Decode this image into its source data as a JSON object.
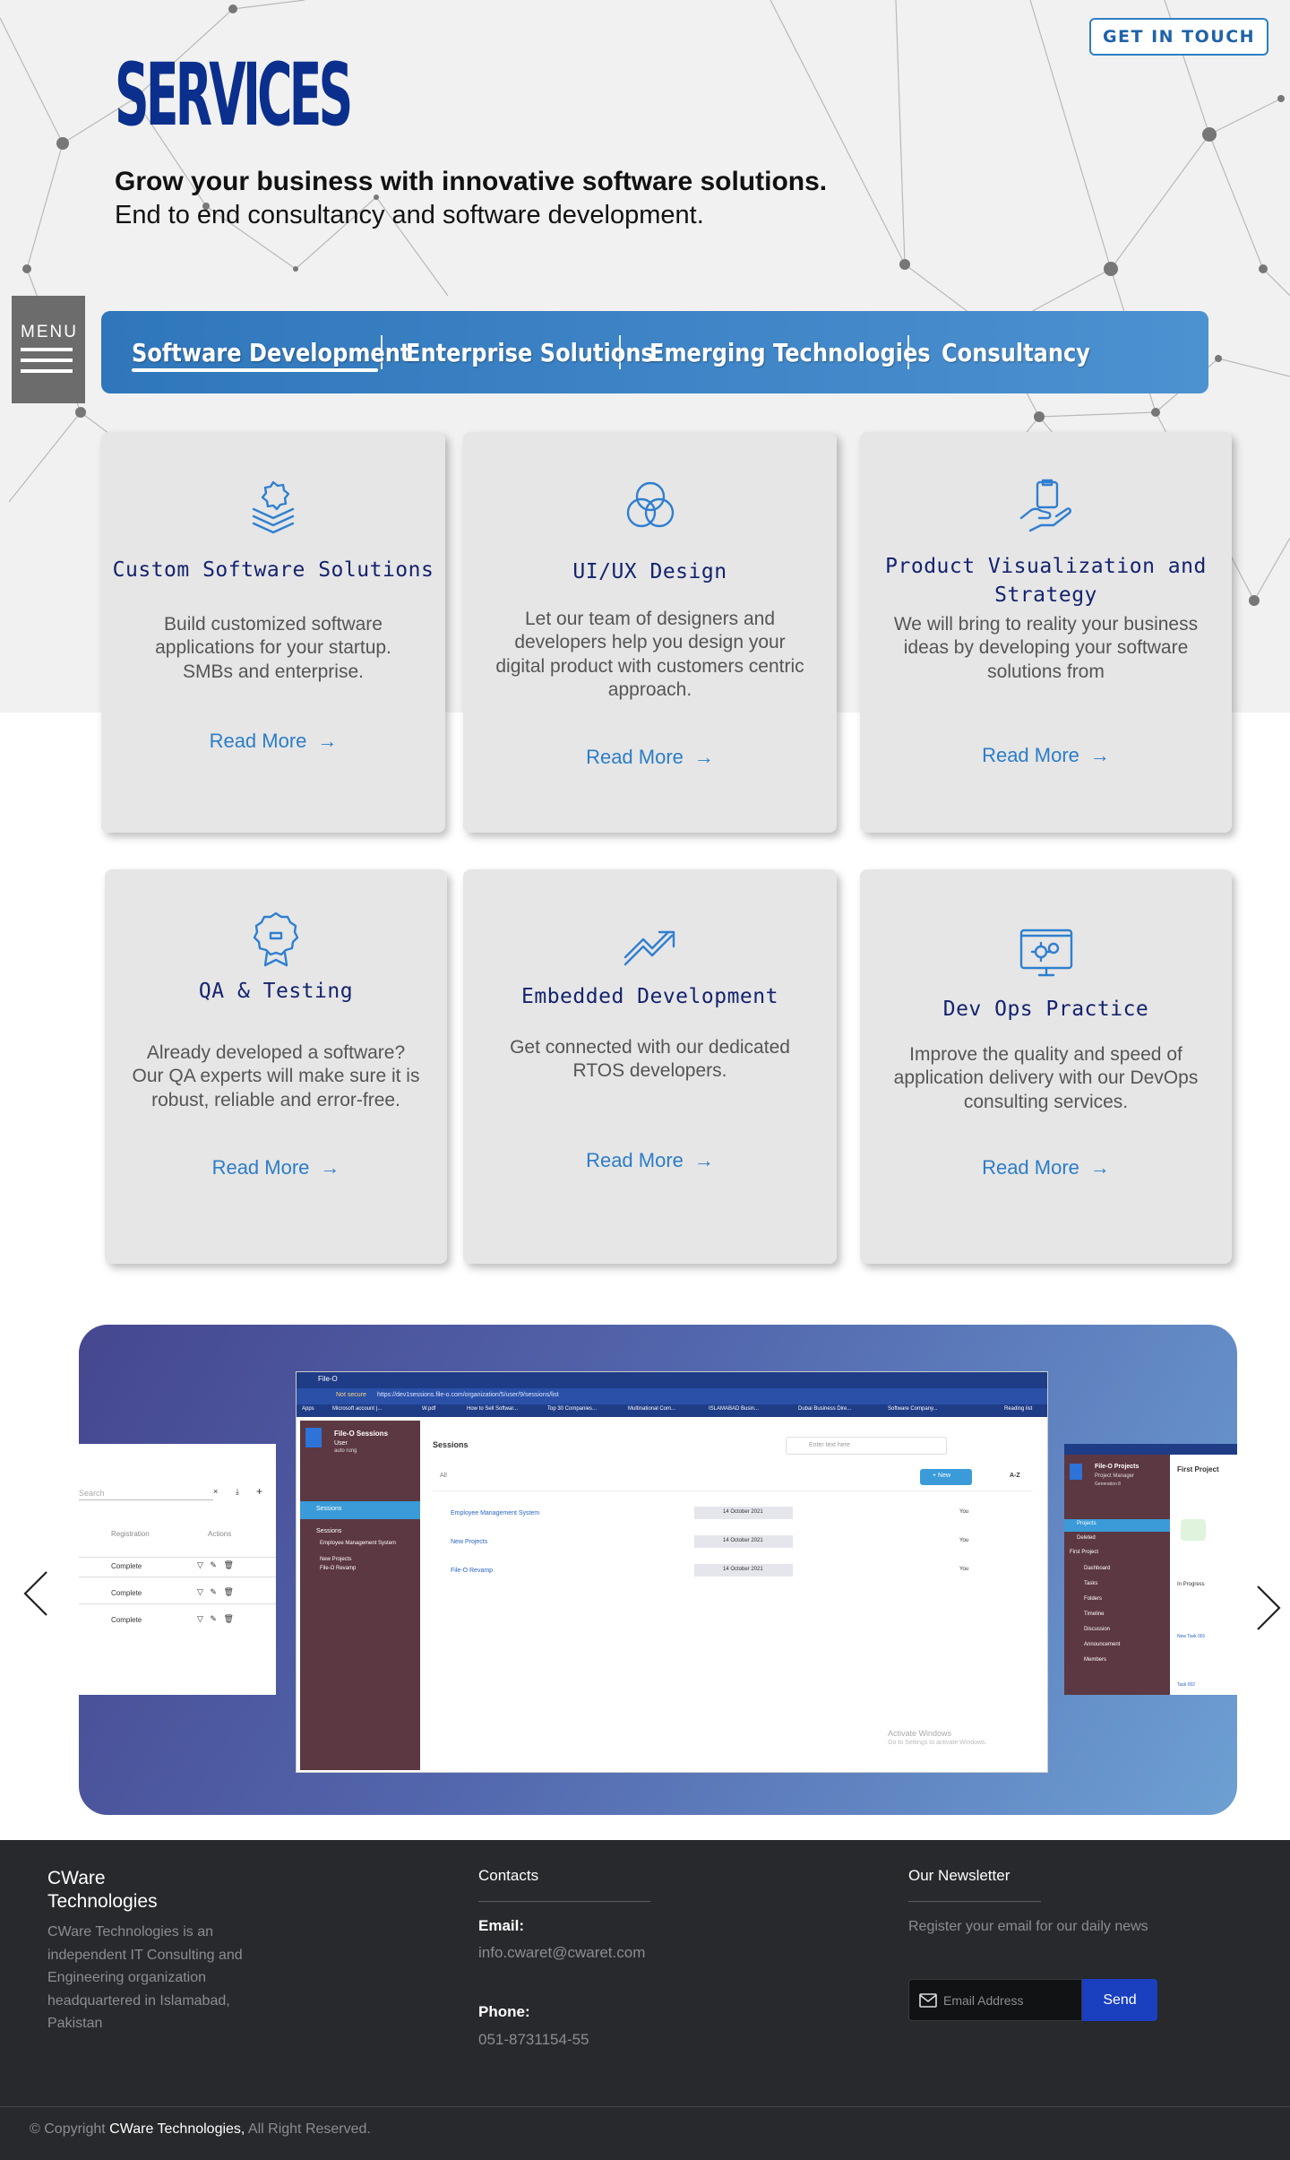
{
  "header": {
    "get_in_touch": "GET IN TOUCH",
    "title": "SERVICES",
    "tagline": "Grow your business with innovative software solutions.",
    "subline": "End to end consultancy and software development.",
    "menu_label": "MENU"
  },
  "tabs": [
    {
      "label": "Software Development",
      "active": true
    },
    {
      "label": "Enterprise Solutions",
      "active": false
    },
    {
      "label": "Emerging Technologies",
      "active": false
    },
    {
      "label": "Consultancy",
      "active": false
    }
  ],
  "cards": [
    {
      "icon": "layers-gear-icon",
      "title": "Custom Software Solutions",
      "desc": "Build customized software applications for your startup. SMBs and enterprise.",
      "link": "Read More"
    },
    {
      "icon": "venn-circles-icon",
      "title": "UI/UX Design",
      "desc": "Let our team of designers and developers help you design your digital product with customers centric approach.",
      "link": "Read More"
    },
    {
      "icon": "hand-clipboard-icon",
      "title": "Product Visualization and Strategy",
      "desc": "We will bring to reality your business ideas by developing your software solutions from",
      "link": "Read More"
    },
    {
      "icon": "badge-award-icon",
      "title": "QA & Testing",
      "desc": "Already developed a software? Our QA experts will make sure it is robust, reliable and error-free.",
      "link": "Read More"
    },
    {
      "icon": "trend-arrow-icon",
      "title": "Embedded Development",
      "desc": "Get connected with our dedicated RTOS developers.",
      "link": "Read More"
    },
    {
      "icon": "monitor-gears-icon",
      "title": "Dev Ops Practice",
      "desc": "Improve the quality and speed of application delivery with our DevOps consulting services.",
      "link": "Read More"
    }
  ],
  "slider": {
    "main": {
      "tab_title": "File-O",
      "url": "https://dev1sessions.file-o.com/organization/5/user/9/sessions/list",
      "not_secure": "Not secure",
      "bookmarks": [
        "Apps",
        "Microsoft account |...",
        "W.pdf",
        "How to Sell Softwar...",
        "Top 30 Companies...",
        "Multinational Com...",
        "ISLAMABAD Busin...",
        "Dubai Business Dire...",
        "Software Company...",
        "Reading list"
      ],
      "app_name": "File-O Sessions",
      "user": "User",
      "user_role": "auto rung",
      "nav_active": "Sessions",
      "nav_items": [
        "Sessions",
        "Employee Management System",
        "New Projects",
        "File-O Revamp"
      ],
      "page_title": "Sessions",
      "search_placeholder": "Enter text here",
      "filter": "All",
      "new_button": "+ New",
      "sort_button": "A-Z",
      "rows": [
        {
          "name": "Employee Management System",
          "date": "14 October 2021",
          "owner": "You"
        },
        {
          "name": "New Projects",
          "date": "14 October 2021",
          "owner": "You"
        },
        {
          "name": "File-O Revamp",
          "date": "14 October 2021",
          "owner": "You"
        }
      ],
      "watermark": "Activate Windows",
      "watermark_sub": "Go to Settings to activate Windows."
    },
    "left": {
      "search": "Search",
      "col_registration": "Registration",
      "col_actions": "Actions",
      "rows": [
        "Complete",
        "Complete",
        "Complete"
      ]
    },
    "right": {
      "app_name": "File-O Projects",
      "user_role": "Project Manager",
      "user_sub": "Generation 8",
      "nav_items": [
        "Projects",
        "Deleted",
        "First Project",
        "Dashboard",
        "Tasks",
        "Folders",
        "Timeline",
        "Discussion",
        "Announcement",
        "Members"
      ],
      "page_title": "First Project",
      "status": "In Progress",
      "task_1": "New Task 001",
      "task_2": "Task 002"
    }
  },
  "footer": {
    "brand": "CWare Technologies",
    "about": "CWare Technologies is an independent IT Consulting and Engineering organization headquartered in Islamabad, Pakistan",
    "contacts_heading": "Contacts",
    "email_label": "Email:",
    "email": "info.cwaret@cwaret.com",
    "phone_label": "Phone:",
    "phone": "051-8731154-55",
    "newsletter_heading": "Our Newsletter",
    "newsletter_text": "Register your email for our daily news",
    "email_placeholder": "Email Address",
    "send": "Send",
    "copyright_prefix": "© Copyright",
    "copyright_brand": "CWare Technologies,",
    "copyright_suffix": "All Right Reserved."
  },
  "colors": {
    "brand_blue": "#0b2f8d",
    "tab_bar": "#2f76bb",
    "link_blue": "#2c7dc7",
    "card_bg": "#e6e6e6",
    "footer_bg": "#27292c",
    "send_button": "#1a3fbf"
  }
}
